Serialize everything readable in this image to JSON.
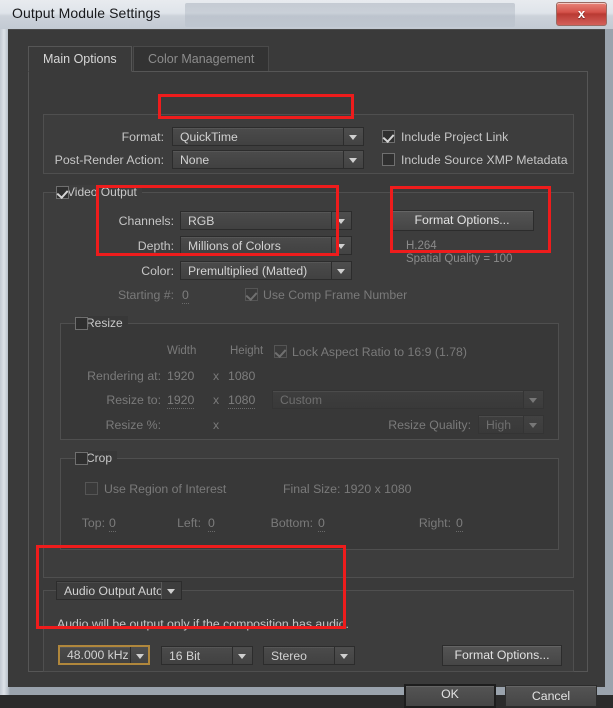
{
  "window": {
    "title": "Output Module Settings",
    "close_label": "x"
  },
  "tabs": [
    {
      "label": "Main Options",
      "active": true
    },
    {
      "label": "Color Management",
      "active": false
    }
  ],
  "format_section": {
    "format_label": "Format:",
    "format_value": "QuickTime",
    "post_render_label": "Post-Render Action:",
    "post_render_value": "None",
    "include_project_link": "Include Project Link",
    "include_xmp": "Include Source XMP Metadata"
  },
  "video_output": {
    "group_label": "Video Output",
    "channels_label": "Channels:",
    "channels_value": "RGB",
    "depth_label": "Depth:",
    "depth_value": "Millions of Colors",
    "color_label": "Color:",
    "color_value": "Premultiplied (Matted)",
    "starting_label": "Starting #:",
    "starting_value": "0",
    "use_comp_frame_number": "Use Comp Frame Number",
    "format_options_button": "Format Options...",
    "codec_line1": "H.264",
    "codec_line2": "Spatial Quality = 100"
  },
  "resize": {
    "group_label": "Resize",
    "width_header": "Width",
    "height_header": "Height",
    "lock_aspect": "Lock Aspect Ratio to  16:9 (1.78)",
    "rendering_at_label": "Rendering at:",
    "rendering_width": "1920",
    "rendering_x": "x",
    "rendering_height": "1080",
    "resize_to_label": "Resize to:",
    "resize_width": "1920",
    "resize_x": "x",
    "resize_height": "1080",
    "preset_value": "Custom",
    "resize_pct_label": "Resize %:",
    "resize_pct_x": "x",
    "quality_label": "Resize Quality:",
    "quality_value": "High"
  },
  "crop": {
    "group_label": "Crop",
    "use_roi": "Use Region of Interest",
    "final_size": "Final Size: 1920 x 1080",
    "top_label": "Top:",
    "top_value": "0",
    "left_label": "Left:",
    "left_value": "0",
    "bottom_label": "Bottom:",
    "bottom_value": "0",
    "right_label": "Right:",
    "right_value": "0"
  },
  "audio": {
    "group_label": "Audio Output Auto",
    "note": "Audio will be output only if the composition has  audio.",
    "sample_rate": "48.000 kHz",
    "bit_depth": "16 Bit",
    "channels": "Stereo",
    "format_options_button": "Format Options..."
  },
  "footer": {
    "ok": "OK",
    "cancel": "Cancel"
  },
  "colors": {
    "annotation": "#ee1c1c",
    "focus": "#b0873c",
    "panel": "#3a3a3a",
    "titlebar": "#dfe4ea"
  }
}
